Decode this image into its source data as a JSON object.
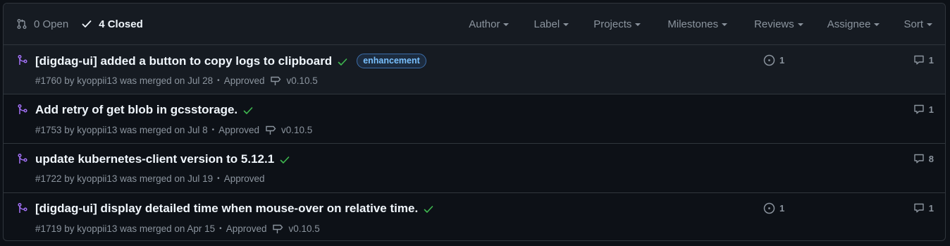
{
  "header": {
    "open_label": "0 Open",
    "closed_label": "4 Closed",
    "filters": [
      "Author",
      "Label",
      "Projects",
      "Milestones",
      "Reviews",
      "Assignee",
      "Sort"
    ]
  },
  "pull_requests": [
    {
      "title": "[digdag-ui] added a button to copy logs to clipboard",
      "label": "enhancement",
      "meta": "#1760 by kyoppii13 was merged on Jul 28",
      "review": "Approved",
      "milestone": "v0.10.5",
      "linked_issues": "1",
      "comments": "1"
    },
    {
      "title": "Add retry of get blob in gcsstorage.",
      "meta": "#1753 by kyoppii13 was merged on Jul 8",
      "review": "Approved",
      "milestone": "v0.10.5",
      "comments": "1"
    },
    {
      "title": "update kubernetes-client version to 5.12.1",
      "meta": "#1722 by kyoppii13 was merged on Jul 19",
      "review": "Approved",
      "comments": "8"
    },
    {
      "title": "[digdag-ui] display detailed time when mouse-over on relative time.",
      "meta": "#1719 by kyoppii13 was merged on Apr 15",
      "review": "Approved",
      "milestone": "v0.10.5",
      "linked_issues": "1",
      "comments": "1"
    }
  ],
  "icons": {
    "open_state": "git-pull-request-icon",
    "closed_state": "check-icon",
    "row": "git-merge-icon",
    "status": "check-icon",
    "milestone": "milestone-icon",
    "linked_issue": "issue-opened-icon",
    "comment": "comment-icon"
  },
  "colors": {
    "background": "#0d1117",
    "header_bg": "#161b22",
    "merged": "#a371f7",
    "success": "#3fb950",
    "label_text": "#79c0ff",
    "muted": "#8b949e"
  }
}
